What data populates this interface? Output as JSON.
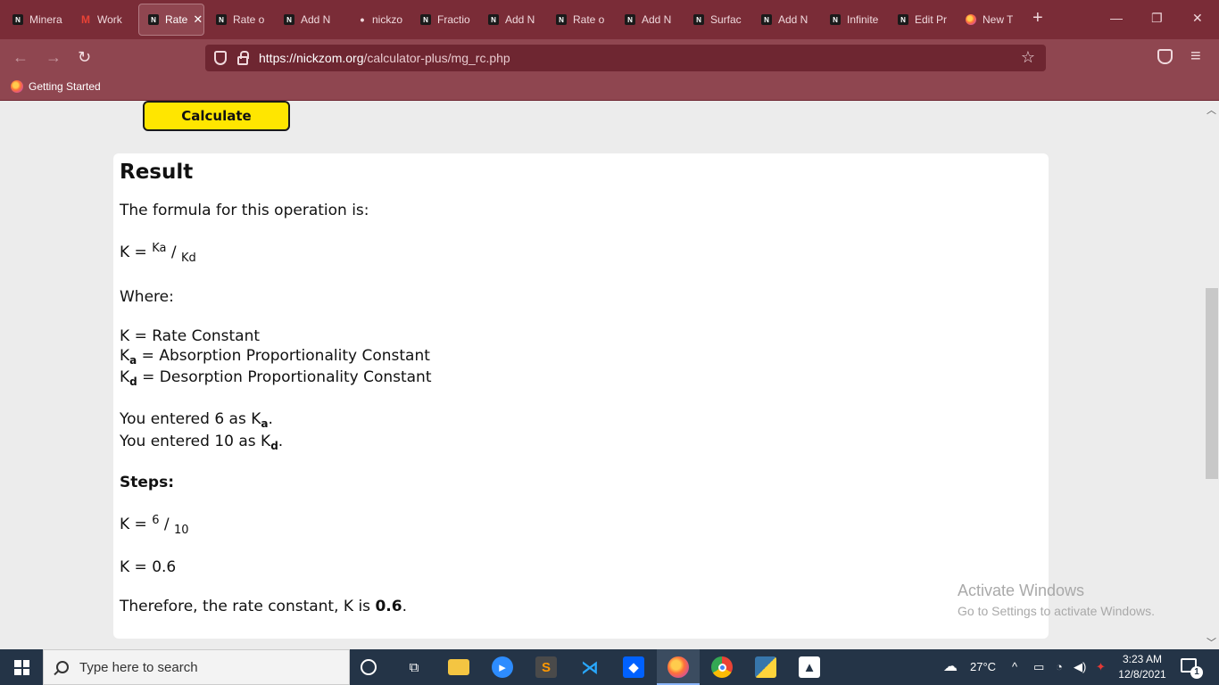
{
  "browser": {
    "tabs": [
      {
        "label": "Minera",
        "icon": "nickzom-icon"
      },
      {
        "label": "Work",
        "icon": "gmail-icon"
      },
      {
        "label": "Rate",
        "icon": "nickzom-icon",
        "active": true
      },
      {
        "label": "Rate o",
        "icon": "nickzom-icon"
      },
      {
        "label": "Add N",
        "icon": "nickzom-icon"
      },
      {
        "label": "nickzo",
        "icon": "dot-icon"
      },
      {
        "label": "Fractio",
        "icon": "nickzom-icon"
      },
      {
        "label": "Add N",
        "icon": "nickzom-icon"
      },
      {
        "label": "Rate o",
        "icon": "nickzom-icon"
      },
      {
        "label": "Add N",
        "icon": "nickzom-icon"
      },
      {
        "label": "Surfac",
        "icon": "nickzom-icon"
      },
      {
        "label": "Add N",
        "icon": "nickzom-icon"
      },
      {
        "label": "Infinite",
        "icon": "nickzom-icon"
      },
      {
        "label": "Edit Pr",
        "icon": "nickzom-icon"
      },
      {
        "label": "New T",
        "icon": "firefox-icon"
      }
    ],
    "close_tab_glyph": "✕",
    "new_tab_glyph": "+",
    "url_host": "https://nickzom.org",
    "url_path": "/calculator-plus/mg_rc.php",
    "bookmark_label": "Getting Started",
    "colors": {
      "tabbar": "#7a2c37",
      "toolbar": "#8f4650",
      "urlbar": "#6e2631"
    }
  },
  "page": {
    "calculate_label": "Calculate",
    "result_title": "Result",
    "formula_intro": "The formula for this operation is:",
    "formula": {
      "lhs": "K =",
      "num": "Ka",
      "slash": "/",
      "den": "Kd"
    },
    "where_label": "Where:",
    "definitions": [
      {
        "sym": "K",
        "sub": "",
        "text": "= Rate Constant"
      },
      {
        "sym": "K",
        "sub": "a",
        "text": "= Absorption Proportionality Constant"
      },
      {
        "sym": "K",
        "sub": "d",
        "text": "= Desorption Proportionality Constant"
      }
    ],
    "entered": [
      {
        "pre": "You entered 6 as K",
        "sub": "a",
        "post": "."
      },
      {
        "pre": "You entered 10 as K",
        "sub": "d",
        "post": "."
      }
    ],
    "steps_label": "Steps:",
    "step1": {
      "lhs": "K =",
      "num": "6",
      "slash": "/",
      "den": "10"
    },
    "step2": "K = 0.6",
    "conclusion": {
      "pre": "Therefore, the rate constant, K is ",
      "value": "0.6",
      "post": "."
    },
    "accent_color": "#ffe600"
  },
  "watermark": {
    "line1": "Activate Windows",
    "line2": "Go to Settings to activate Windows."
  },
  "taskbar": {
    "search_placeholder": "Type here to search",
    "weather": "27°C",
    "time": "3:23 AM",
    "date": "12/8/2021",
    "notification_count": "1",
    "apps": [
      "cortana-icon",
      "task-view-icon",
      "file-explorer-icon",
      "zoom-icon",
      "sublime-text-icon",
      "vscode-icon",
      "dropbox-icon",
      "firefox-icon",
      "chrome-icon",
      "python-icon",
      "photos-icon"
    ]
  }
}
